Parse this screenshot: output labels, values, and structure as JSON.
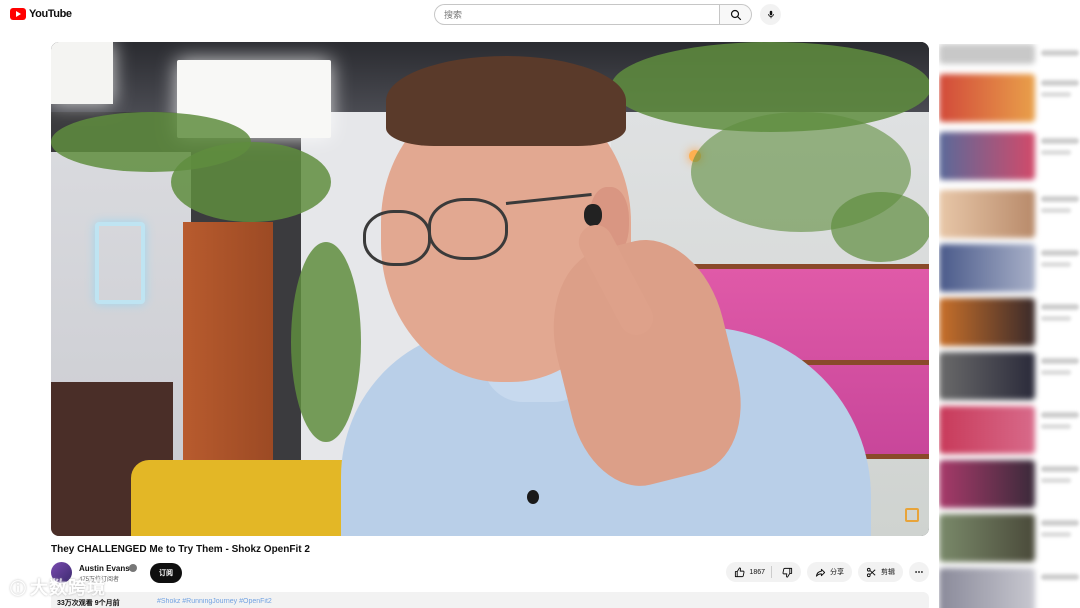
{
  "masthead": {
    "logo_text": "YouTube",
    "search_placeholder": "搜索"
  },
  "video": {
    "title": "They CHALLENGED Me to Try Them - Shokz OpenFit 2"
  },
  "channel": {
    "name": "Austin Evans",
    "subscribers": "475万位订阅者",
    "subscribe_label": "订阅"
  },
  "actions": {
    "like_count": "1867",
    "share_label": "分享",
    "clip_label": "剪辑"
  },
  "description": {
    "views_and_date": "33万次观看  9个月前",
    "tags": "#Shokz #RunningJourney #OpenFit2"
  },
  "watermark": {
    "text": "大数跨境"
  },
  "colors": {
    "brand_red": "#ff0000",
    "subscribe_bg": "#0f0f0f",
    "pill_bg": "#f2f2f2",
    "link_blue": "#065fd4"
  },
  "icons": [
    "youtube-logo-icon",
    "search-icon",
    "mic-icon",
    "verified-icon",
    "like-icon",
    "dislike-icon",
    "share-icon",
    "scissors-icon",
    "more-icon"
  ]
}
